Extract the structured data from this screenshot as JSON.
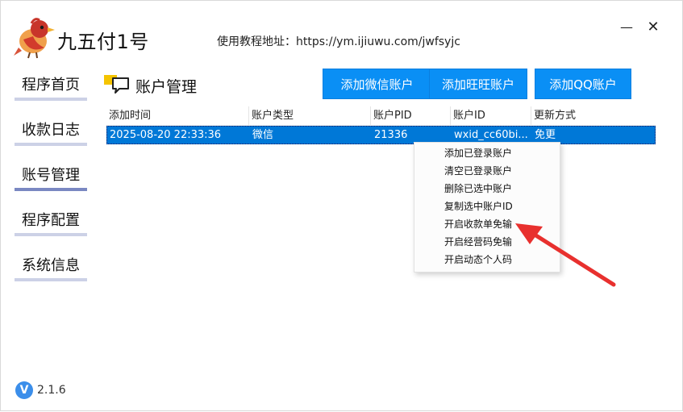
{
  "app": {
    "title": "九五付1号",
    "tutorial_text": "使用教程地址：https://ym.ijiuwu.com/jwfsyjc",
    "minimize": "—",
    "close": "✕"
  },
  "sidebar": {
    "items": [
      {
        "label": "程序首页"
      },
      {
        "label": "收款日志"
      },
      {
        "label": "账号管理"
      },
      {
        "label": "程序配置"
      },
      {
        "label": "系统信息"
      }
    ],
    "active_index": 2
  },
  "main": {
    "section_title": "账户管理",
    "buttons": {
      "add_wechat": "添加微信账户",
      "add_wangwang": "添加旺旺账户",
      "add_qq": "添加QQ账户"
    },
    "table": {
      "columns": [
        "添加时间",
        "账户类型",
        "账户PID",
        "账户ID",
        "更新方式"
      ],
      "rows": [
        [
          "2025-08-20 22:33:36",
          "微信",
          "21336",
          "wxid_cc60bi...",
          "免更"
        ]
      ]
    },
    "context_menu": [
      "添加已登录账户",
      "清空已登录账户",
      "删除已选中账户",
      "复制选中账户ID",
      "开启收款单免输",
      "开启经营码免输",
      "开启动态个人码"
    ]
  },
  "footer": {
    "version_badge": "V",
    "version": "2.1.6"
  },
  "colors": {
    "button_blue": "#0a8ff5",
    "selection_blue": "#0078d7",
    "nav_underline": "#ccd1e6",
    "nav_active_underline": "#7a88c2",
    "arrow_red": "#e8302e"
  }
}
